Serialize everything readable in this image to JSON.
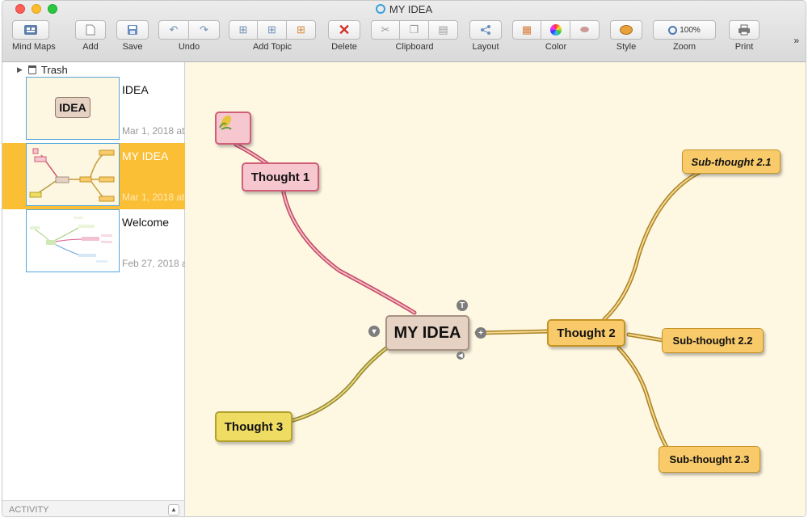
{
  "window": {
    "title": "MY IDEA"
  },
  "toolbar": {
    "mind_maps": "Mind Maps",
    "add": "Add",
    "save": "Save",
    "undo": "Undo",
    "add_topic": "Add Topic",
    "delete": "Delete",
    "clipboard": "Clipboard",
    "layout": "Layout",
    "color": "Color",
    "style": "Style",
    "zoom": "Zoom",
    "zoom_value": "100%",
    "print": "Print",
    "overflow": "»"
  },
  "sidebar": {
    "trash": "Trash",
    "documents": [
      {
        "name": "IDEA",
        "date": "Mar 1, 2018 at",
        "thumb_label": "IDEA"
      },
      {
        "name": "MY IDEA",
        "date": "Mar 1, 2018 at"
      },
      {
        "name": "Welcome",
        "date": "Feb 27, 2018 a"
      }
    ],
    "activity": "ACTIVITY"
  },
  "mindmap": {
    "root": "MY IDEA",
    "thought1": "Thought 1",
    "thought2": "Thought 2",
    "thought3": "Thought 3",
    "sub1": "Sub-thought 2.1",
    "sub2": "Sub-thought 2.2",
    "sub3": "Sub-thought 2.3",
    "icon": "corn-icon"
  },
  "colors": {
    "selection": "#fbbf36",
    "canvas": "#fef7e2",
    "pink_branch": "#d05b72",
    "orange_branch": "#c69a3a",
    "yellow_branch": "#b2a246"
  }
}
